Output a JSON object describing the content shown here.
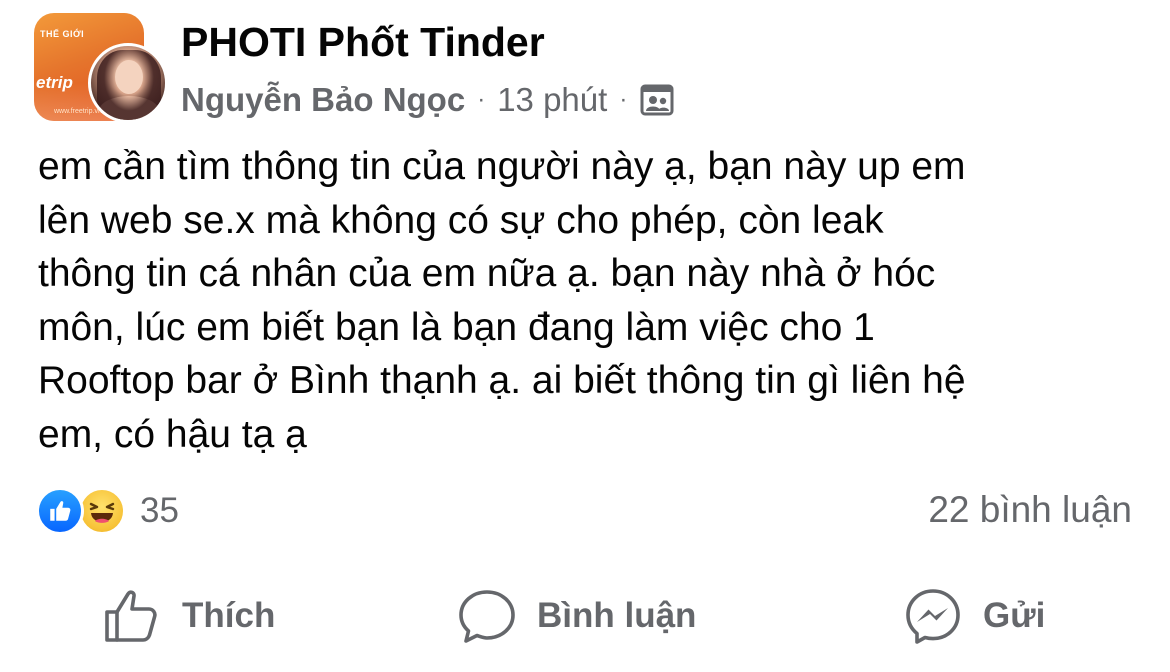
{
  "header": {
    "group_name": "PHOTI Phốt Tinder",
    "author": "Nguyễn Bảo Ngọc",
    "separator": "·",
    "time": "13 phút",
    "group_avatar_text": {
      "line1": "THẾ GIỚI",
      "line2": "etrip",
      "line3": "www.freetrip.vn"
    },
    "icons": {
      "privacy": "group-members-icon"
    }
  },
  "post": {
    "lines": [
      "em cần tìm thông tin của người này ạ, bạn này up em",
      "lên web se.x mà không có sự cho phép, còn leak",
      "thông tin cá nhân của em nữa ạ. bạn này nhà ở hóc",
      "môn, lúc em biết bạn là bạn đang làm việc cho 1",
      "Rooftop bar ở Bình thạnh ạ. ai biết thông tin gì liên hệ",
      "em, có hậu tạ ạ"
    ]
  },
  "reactions": {
    "types": [
      "like-icon",
      "haha-icon"
    ],
    "count": "35",
    "comments": "22 bình luận"
  },
  "actions": {
    "like_label": "Thích",
    "comment_label": "Bình luận",
    "send_label": "Gửi"
  },
  "colors": {
    "text_primary": "#050505",
    "text_secondary": "#65676b",
    "like_blue": "#0866ff",
    "haha_yellow": "#f7c237"
  }
}
